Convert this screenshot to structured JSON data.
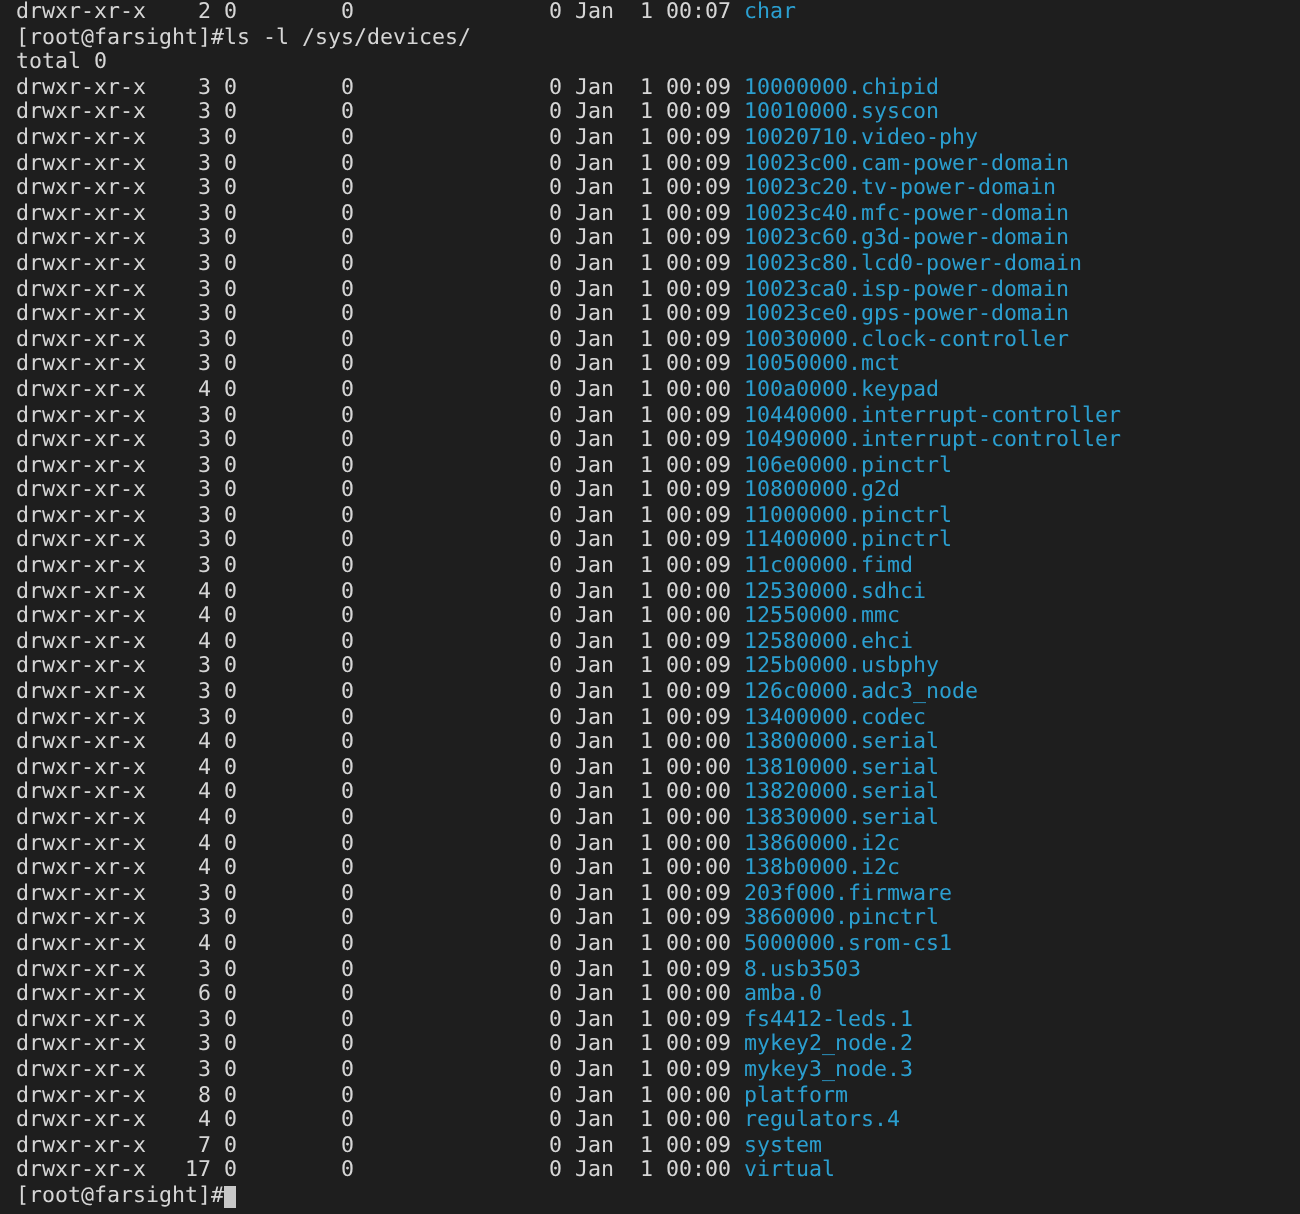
{
  "terminal": {
    "lines_before": [
      {
        "mode": "drwxr-xr-x",
        "links": "2",
        "owner": "0",
        "group": "0",
        "size": "0",
        "month": "Jan",
        "day": "1",
        "time": "00:07",
        "name": "char"
      }
    ],
    "command_prompt": {
      "prompt": "[root@farsight]#",
      "command": "ls -l /sys/devices/"
    },
    "total": "total 0",
    "entries": [
      {
        "mode": "drwxr-xr-x",
        "links": "3",
        "owner": "0",
        "group": "0",
        "size": "0",
        "month": "Jan",
        "day": "1",
        "time": "00:09",
        "name": "10000000.chipid"
      },
      {
        "mode": "drwxr-xr-x",
        "links": "3",
        "owner": "0",
        "group": "0",
        "size": "0",
        "month": "Jan",
        "day": "1",
        "time": "00:09",
        "name": "10010000.syscon"
      },
      {
        "mode": "drwxr-xr-x",
        "links": "3",
        "owner": "0",
        "group": "0",
        "size": "0",
        "month": "Jan",
        "day": "1",
        "time": "00:09",
        "name": "10020710.video-phy"
      },
      {
        "mode": "drwxr-xr-x",
        "links": "3",
        "owner": "0",
        "group": "0",
        "size": "0",
        "month": "Jan",
        "day": "1",
        "time": "00:09",
        "name": "10023c00.cam-power-domain"
      },
      {
        "mode": "drwxr-xr-x",
        "links": "3",
        "owner": "0",
        "group": "0",
        "size": "0",
        "month": "Jan",
        "day": "1",
        "time": "00:09",
        "name": "10023c20.tv-power-domain"
      },
      {
        "mode": "drwxr-xr-x",
        "links": "3",
        "owner": "0",
        "group": "0",
        "size": "0",
        "month": "Jan",
        "day": "1",
        "time": "00:09",
        "name": "10023c40.mfc-power-domain"
      },
      {
        "mode": "drwxr-xr-x",
        "links": "3",
        "owner": "0",
        "group": "0",
        "size": "0",
        "month": "Jan",
        "day": "1",
        "time": "00:09",
        "name": "10023c60.g3d-power-domain"
      },
      {
        "mode": "drwxr-xr-x",
        "links": "3",
        "owner": "0",
        "group": "0",
        "size": "0",
        "month": "Jan",
        "day": "1",
        "time": "00:09",
        "name": "10023c80.lcd0-power-domain"
      },
      {
        "mode": "drwxr-xr-x",
        "links": "3",
        "owner": "0",
        "group": "0",
        "size": "0",
        "month": "Jan",
        "day": "1",
        "time": "00:09",
        "name": "10023ca0.isp-power-domain"
      },
      {
        "mode": "drwxr-xr-x",
        "links": "3",
        "owner": "0",
        "group": "0",
        "size": "0",
        "month": "Jan",
        "day": "1",
        "time": "00:09",
        "name": "10023ce0.gps-power-domain"
      },
      {
        "mode": "drwxr-xr-x",
        "links": "3",
        "owner": "0",
        "group": "0",
        "size": "0",
        "month": "Jan",
        "day": "1",
        "time": "00:09",
        "name": "10030000.clock-controller"
      },
      {
        "mode": "drwxr-xr-x",
        "links": "3",
        "owner": "0",
        "group": "0",
        "size": "0",
        "month": "Jan",
        "day": "1",
        "time": "00:09",
        "name": "10050000.mct"
      },
      {
        "mode": "drwxr-xr-x",
        "links": "4",
        "owner": "0",
        "group": "0",
        "size": "0",
        "month": "Jan",
        "day": "1",
        "time": "00:00",
        "name": "100a0000.keypad"
      },
      {
        "mode": "drwxr-xr-x",
        "links": "3",
        "owner": "0",
        "group": "0",
        "size": "0",
        "month": "Jan",
        "day": "1",
        "time": "00:09",
        "name": "10440000.interrupt-controller"
      },
      {
        "mode": "drwxr-xr-x",
        "links": "3",
        "owner": "0",
        "group": "0",
        "size": "0",
        "month": "Jan",
        "day": "1",
        "time": "00:09",
        "name": "10490000.interrupt-controller"
      },
      {
        "mode": "drwxr-xr-x",
        "links": "3",
        "owner": "0",
        "group": "0",
        "size": "0",
        "month": "Jan",
        "day": "1",
        "time": "00:09",
        "name": "106e0000.pinctrl"
      },
      {
        "mode": "drwxr-xr-x",
        "links": "3",
        "owner": "0",
        "group": "0",
        "size": "0",
        "month": "Jan",
        "day": "1",
        "time": "00:09",
        "name": "10800000.g2d"
      },
      {
        "mode": "drwxr-xr-x",
        "links": "3",
        "owner": "0",
        "group": "0",
        "size": "0",
        "month": "Jan",
        "day": "1",
        "time": "00:09",
        "name": "11000000.pinctrl"
      },
      {
        "mode": "drwxr-xr-x",
        "links": "3",
        "owner": "0",
        "group": "0",
        "size": "0",
        "month": "Jan",
        "day": "1",
        "time": "00:09",
        "name": "11400000.pinctrl"
      },
      {
        "mode": "drwxr-xr-x",
        "links": "3",
        "owner": "0",
        "group": "0",
        "size": "0",
        "month": "Jan",
        "day": "1",
        "time": "00:09",
        "name": "11c00000.fimd"
      },
      {
        "mode": "drwxr-xr-x",
        "links": "4",
        "owner": "0",
        "group": "0",
        "size": "0",
        "month": "Jan",
        "day": "1",
        "time": "00:00",
        "name": "12530000.sdhci"
      },
      {
        "mode": "drwxr-xr-x",
        "links": "4",
        "owner": "0",
        "group": "0",
        "size": "0",
        "month": "Jan",
        "day": "1",
        "time": "00:00",
        "name": "12550000.mmc"
      },
      {
        "mode": "drwxr-xr-x",
        "links": "4",
        "owner": "0",
        "group": "0",
        "size": "0",
        "month": "Jan",
        "day": "1",
        "time": "00:09",
        "name": "12580000.ehci"
      },
      {
        "mode": "drwxr-xr-x",
        "links": "3",
        "owner": "0",
        "group": "0",
        "size": "0",
        "month": "Jan",
        "day": "1",
        "time": "00:09",
        "name": "125b0000.usbphy"
      },
      {
        "mode": "drwxr-xr-x",
        "links": "3",
        "owner": "0",
        "group": "0",
        "size": "0",
        "month": "Jan",
        "day": "1",
        "time": "00:09",
        "name": "126c0000.adc3_node"
      },
      {
        "mode": "drwxr-xr-x",
        "links": "3",
        "owner": "0",
        "group": "0",
        "size": "0",
        "month": "Jan",
        "day": "1",
        "time": "00:09",
        "name": "13400000.codec"
      },
      {
        "mode": "drwxr-xr-x",
        "links": "4",
        "owner": "0",
        "group": "0",
        "size": "0",
        "month": "Jan",
        "day": "1",
        "time": "00:00",
        "name": "13800000.serial"
      },
      {
        "mode": "drwxr-xr-x",
        "links": "4",
        "owner": "0",
        "group": "0",
        "size": "0",
        "month": "Jan",
        "day": "1",
        "time": "00:00",
        "name": "13810000.serial"
      },
      {
        "mode": "drwxr-xr-x",
        "links": "4",
        "owner": "0",
        "group": "0",
        "size": "0",
        "month": "Jan",
        "day": "1",
        "time": "00:00",
        "name": "13820000.serial"
      },
      {
        "mode": "drwxr-xr-x",
        "links": "4",
        "owner": "0",
        "group": "0",
        "size": "0",
        "month": "Jan",
        "day": "1",
        "time": "00:00",
        "name": "13830000.serial"
      },
      {
        "mode": "drwxr-xr-x",
        "links": "4",
        "owner": "0",
        "group": "0",
        "size": "0",
        "month": "Jan",
        "day": "1",
        "time": "00:00",
        "name": "13860000.i2c"
      },
      {
        "mode": "drwxr-xr-x",
        "links": "4",
        "owner": "0",
        "group": "0",
        "size": "0",
        "month": "Jan",
        "day": "1",
        "time": "00:00",
        "name": "138b0000.i2c"
      },
      {
        "mode": "drwxr-xr-x",
        "links": "3",
        "owner": "0",
        "group": "0",
        "size": "0",
        "month": "Jan",
        "day": "1",
        "time": "00:09",
        "name": "203f000.firmware"
      },
      {
        "mode": "drwxr-xr-x",
        "links": "3",
        "owner": "0",
        "group": "0",
        "size": "0",
        "month": "Jan",
        "day": "1",
        "time": "00:09",
        "name": "3860000.pinctrl"
      },
      {
        "mode": "drwxr-xr-x",
        "links": "4",
        "owner": "0",
        "group": "0",
        "size": "0",
        "month": "Jan",
        "day": "1",
        "time": "00:00",
        "name": "5000000.srom-cs1"
      },
      {
        "mode": "drwxr-xr-x",
        "links": "3",
        "owner": "0",
        "group": "0",
        "size": "0",
        "month": "Jan",
        "day": "1",
        "time": "00:09",
        "name": "8.usb3503"
      },
      {
        "mode": "drwxr-xr-x",
        "links": "6",
        "owner": "0",
        "group": "0",
        "size": "0",
        "month": "Jan",
        "day": "1",
        "time": "00:00",
        "name": "amba.0"
      },
      {
        "mode": "drwxr-xr-x",
        "links": "3",
        "owner": "0",
        "group": "0",
        "size": "0",
        "month": "Jan",
        "day": "1",
        "time": "00:09",
        "name": "fs4412-leds.1"
      },
      {
        "mode": "drwxr-xr-x",
        "links": "3",
        "owner": "0",
        "group": "0",
        "size": "0",
        "month": "Jan",
        "day": "1",
        "time": "00:09",
        "name": "mykey2_node.2"
      },
      {
        "mode": "drwxr-xr-x",
        "links": "3",
        "owner": "0",
        "group": "0",
        "size": "0",
        "month": "Jan",
        "day": "1",
        "time": "00:09",
        "name": "mykey3_node.3"
      },
      {
        "mode": "drwxr-xr-x",
        "links": "8",
        "owner": "0",
        "group": "0",
        "size": "0",
        "month": "Jan",
        "day": "1",
        "time": "00:00",
        "name": "platform"
      },
      {
        "mode": "drwxr-xr-x",
        "links": "4",
        "owner": "0",
        "group": "0",
        "size": "0",
        "month": "Jan",
        "day": "1",
        "time": "00:00",
        "name": "regulators.4"
      },
      {
        "mode": "drwxr-xr-x",
        "links": "7",
        "owner": "0",
        "group": "0",
        "size": "0",
        "month": "Jan",
        "day": "1",
        "time": "00:09",
        "name": "system"
      },
      {
        "mode": "drwxr-xr-x",
        "links": "17",
        "owner": "0",
        "group": "0",
        "size": "0",
        "month": "Jan",
        "day": "1",
        "time": "00:00",
        "name": "virtual"
      }
    ],
    "final_prompt": {
      "prompt": "[root@farsight]#"
    }
  }
}
